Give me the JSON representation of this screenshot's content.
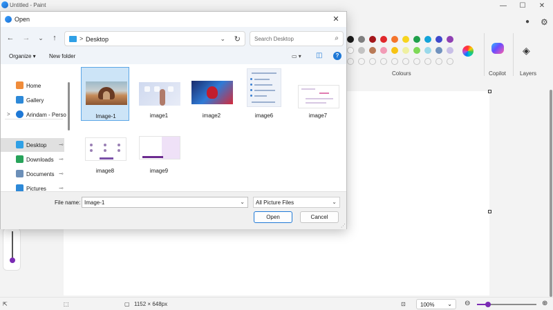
{
  "paint": {
    "title": "Untitled - Paint",
    "window_controls": {
      "minimize": "—",
      "maximize": "☐",
      "close": "✕"
    },
    "groups": {
      "colours": "Colours",
      "copilot": "Copilot",
      "layers": "Layers"
    },
    "palette_row1": [
      "#1a1a1a",
      "#7f7f7f",
      "#a4161a",
      "#e0272b",
      "#f4742b",
      "#f7d41d",
      "#1f9f4a",
      "#12a3d9",
      "#3f48cc",
      "#8f3fb3"
    ],
    "palette_row2": [
      "#ffffff",
      "#c3c3c3",
      "#b97a57",
      "#f29bb6",
      "#f7c313",
      "#eff0a1",
      "#7ed957",
      "#99d9ea",
      "#7092be",
      "#c8bfe7"
    ],
    "status": {
      "canvas_size": "1152 × 648px",
      "zoom": "100%"
    }
  },
  "dialog": {
    "title": "Open",
    "close_icon": "✕",
    "nav": {
      "back": "←",
      "forward": "→",
      "recent": "⌄",
      "up": "↑"
    },
    "address": {
      "separator": ">",
      "location": "Desktop",
      "dropdown": "⌄",
      "refresh": "↻"
    },
    "search": {
      "placeholder": "Search Desktop",
      "icon": "⌕"
    },
    "commands": {
      "organize": "Organize ▾",
      "new_folder": "New folder",
      "view_icon": "▭ ▾",
      "pane_icon": "◫",
      "help_icon": "?"
    },
    "nav_pane": [
      {
        "label": "Home",
        "color": "#f08c3a"
      },
      {
        "label": "Gallery",
        "color": "#2d89d8"
      },
      {
        "label": "Arindam - Perso",
        "color": "#1e78d6",
        "expand": ">"
      },
      {
        "label": "Desktop",
        "color": "#2fa0e6",
        "pin": "📌"
      },
      {
        "label": "Downloads",
        "color": "#27a35a",
        "pin": "📌"
      },
      {
        "label": "Documents",
        "color": "#6c8fb8",
        "pin": "📌"
      },
      {
        "label": "Pictures",
        "color": "#2d89d8",
        "pin": "📌"
      }
    ],
    "files": [
      {
        "name": "Image-1"
      },
      {
        "name": "image1"
      },
      {
        "name": "image2"
      },
      {
        "name": "image6"
      },
      {
        "name": "image7"
      },
      {
        "name": "image8"
      },
      {
        "name": "image9"
      }
    ],
    "footer": {
      "file_name_label": "File name:",
      "file_name_value": "Image-1",
      "file_type": "All Picture Files",
      "dropdown": "⌄",
      "open_button": "Open",
      "cancel_button": "Cancel"
    }
  }
}
